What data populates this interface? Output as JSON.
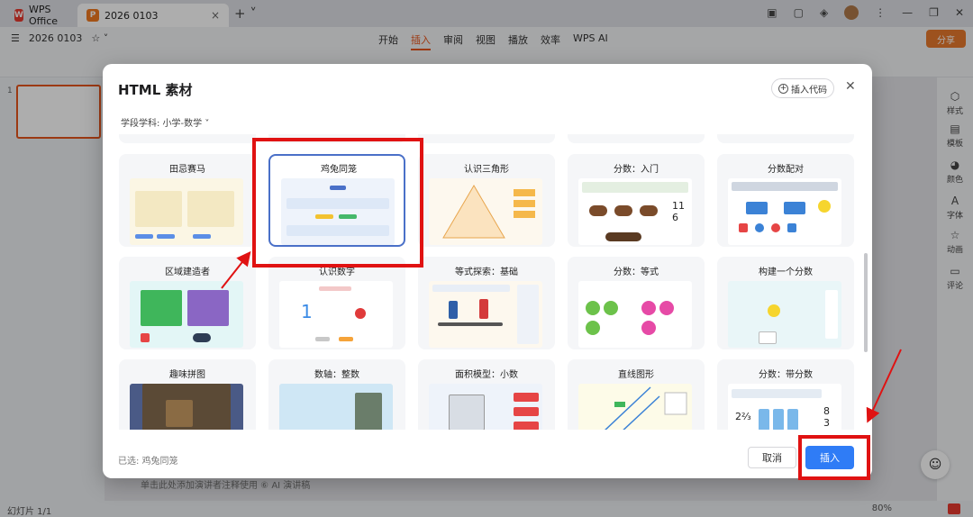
{
  "app": {
    "wps_tab": "WPS Office",
    "doc_tab": "2026 0103",
    "doc_title": "2026 0103",
    "menu": [
      "开始",
      "插入",
      "审阅",
      "视图",
      "播放",
      "效率",
      "WPS AI"
    ],
    "active_menu": "插入",
    "share": "分享",
    "right_panel": [
      "样式",
      "模板",
      "颜色",
      "字体",
      "动画",
      "评论"
    ],
    "notes_text": "单击此处添加演讲者注释使用  ⑥ AI 演讲稿",
    "status_slides": "幻灯片 1/1",
    "status_zoom": "80%"
  },
  "dialog": {
    "title": "HTML 素材",
    "insert_code": "插入代码",
    "subject_filter": "学段学科: 小学-数学",
    "cards": [
      {
        "title": "田忌赛马"
      },
      {
        "title": "鸡兔同笼",
        "selected": true
      },
      {
        "title": "认识三角形"
      },
      {
        "title": "分数：入门"
      },
      {
        "title": "分数配对"
      },
      {
        "title": "区域建造者"
      },
      {
        "title": "认识数字"
      },
      {
        "title": "等式探索：基础"
      },
      {
        "title": "分数：等式"
      },
      {
        "title": "构建一个分数"
      },
      {
        "title": "趣味拼图"
      },
      {
        "title": "数轴：整数"
      },
      {
        "title": "面积模型：小数"
      },
      {
        "title": "直线图形"
      },
      {
        "title": "分数：带分数"
      }
    ],
    "selected_text": "已选: 鸡兔同笼",
    "cancel": "取消",
    "insert": "插入"
  },
  "annotation_color": "#e01212"
}
